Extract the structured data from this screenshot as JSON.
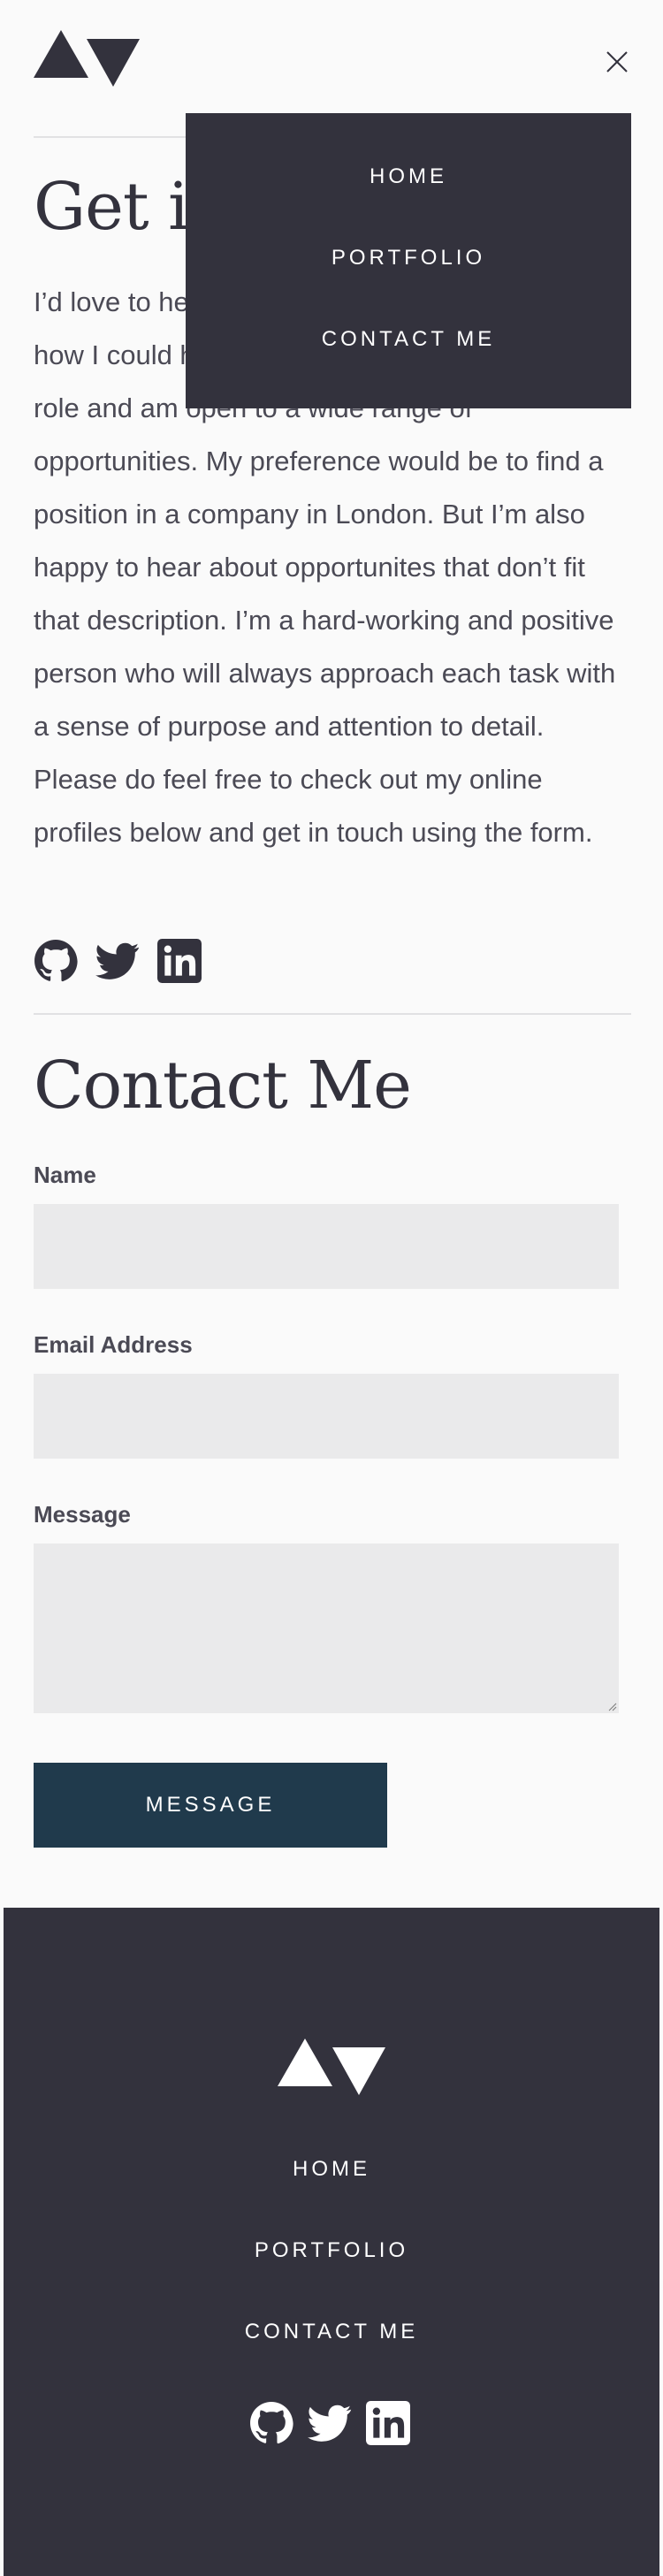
{
  "header": {
    "logo_icon": "triangles-logo-icon",
    "close_icon": "close-icon"
  },
  "mobile_menu": {
    "items": [
      {
        "label": "HOME"
      },
      {
        "label": "PORTFOLIO"
      },
      {
        "label": "CONTACT ME"
      }
    ]
  },
  "get_in_touch": {
    "title": "Get in touch",
    "body": "I’d love to hear about what you’re working on and how I could help. I’m currently looking for a new role and am open to a wide range of opportunities. My preference would be to find a position in a company in London. But I’m also happy to hear about opportunites that don’t fit that description. I’m a hard-working and positive person who will always approach each task with a sense of purpose and attention to detail. Please do feel free to check out my online profiles below and get in touch using the form."
  },
  "social": {
    "icons": [
      "github-icon",
      "twitter-icon",
      "linkedin-icon"
    ]
  },
  "contact": {
    "title": "Contact Me",
    "name_label": "Name",
    "name_value": "",
    "email_label": "Email Address",
    "email_value": "",
    "message_label": "Message",
    "message_value": "",
    "submit_label": "MESSAGE"
  },
  "footer": {
    "logo_icon": "triangles-logo-icon",
    "nav": [
      {
        "label": "HOME"
      },
      {
        "label": "PORTFOLIO"
      },
      {
        "label": "CONTACT ME"
      }
    ]
  },
  "colors": {
    "background": "#fafafa",
    "text_dark": "#33323d",
    "text_body": "#4b4a55",
    "button": "#203a4c",
    "field": "#eaeaeb",
    "footer": "#33323d",
    "divider": "#e1e1e3"
  }
}
